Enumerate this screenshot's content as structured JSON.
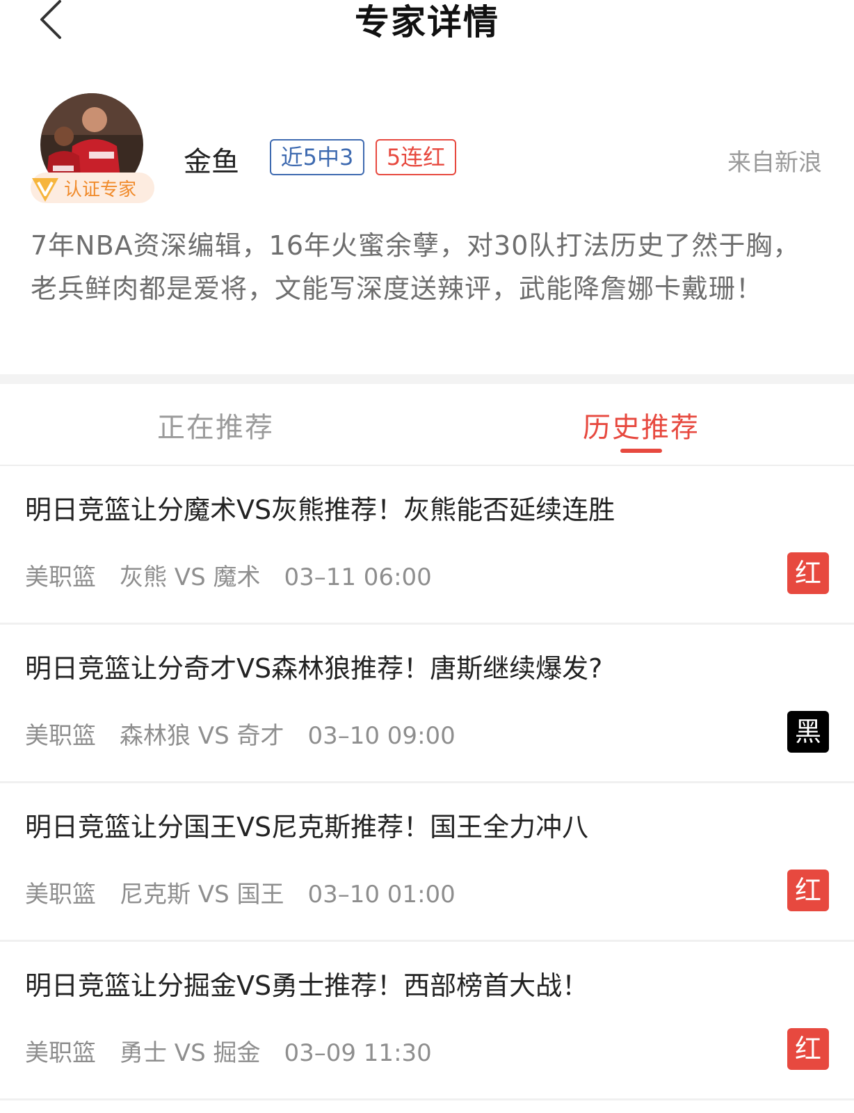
{
  "header": {
    "title": "专家详情"
  },
  "profile": {
    "name": "金鱼",
    "badge_certified": "认证专家",
    "tag_record": "近5中3",
    "tag_streak": "5连红",
    "source": "来自新浪",
    "intro": "7年NBA资深编辑，16年火蜜余孽，对30队打法历史了然于胸，老兵鲜肉都是爱将，文能写深度送辣评，武能降詹娜卡戴珊！"
  },
  "tabs": [
    {
      "label": "正在推荐",
      "active": false
    },
    {
      "label": "历史推荐",
      "active": true
    }
  ],
  "colors": {
    "red": "#e7493f",
    "black": "#000000",
    "blue": "#3e6ab0"
  },
  "items": [
    {
      "title": "明日竞篮让分魔术VS灰熊推荐！灰熊能否延续连胜",
      "league": "美职篮",
      "match": "灰熊 VS 魔术",
      "time": "03–11 06:00",
      "result": "红",
      "result_color": "red"
    },
    {
      "title": "明日竞篮让分奇才VS森林狼推荐！唐斯继续爆发?",
      "league": "美职篮",
      "match": "森林狼 VS 奇才",
      "time": "03–10 09:00",
      "result": "黑",
      "result_color": "black"
    },
    {
      "title": "明日竞篮让分国王VS尼克斯推荐！国王全力冲八",
      "league": "美职篮",
      "match": "尼克斯 VS 国王",
      "time": "03–10 01:00",
      "result": "红",
      "result_color": "red"
    },
    {
      "title": "明日竞篮让分掘金VS勇士推荐！西部榜首大战！",
      "league": "美职篮",
      "match": "勇士 VS 掘金",
      "time": "03–09 11:30",
      "result": "红",
      "result_color": "red"
    }
  ]
}
